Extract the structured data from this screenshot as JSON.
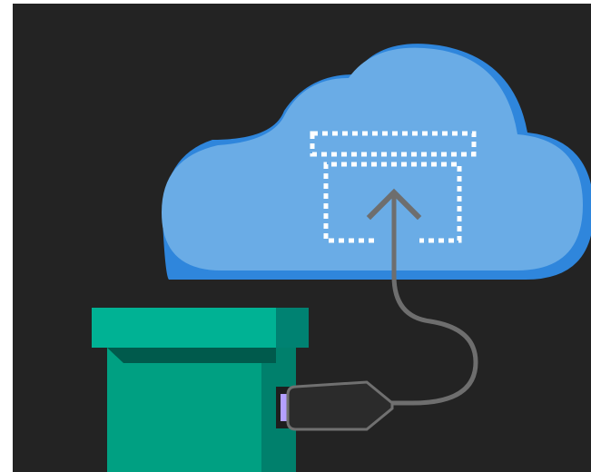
{
  "illustration": {
    "background_color": "#232323",
    "cloud": {
      "icon": "cloud-icon",
      "fill_color": "#6aace6",
      "shadow_color": "#2f86dc"
    },
    "target_box": {
      "icon": "dotted-box-icon",
      "stroke_color": "#ffffff"
    },
    "upload_arrow": {
      "icon": "arrow-up-icon",
      "stroke_color": "#6e6e6e"
    },
    "cable": {
      "icon": "cable-icon",
      "stroke_color": "#6e6e6e"
    },
    "box": {
      "icon": "box-icon",
      "lid_color": "#00b294",
      "lid_side_color": "#008272",
      "body_color": "#00a082",
      "body_side_color": "#00806c",
      "shadow_color": "#005a4c"
    },
    "connector": {
      "icon": "usb-connector-icon",
      "plug_color": "#2b2b2b",
      "plug_edge_color": "#707070",
      "tip_color": "#b4a0ff"
    }
  }
}
